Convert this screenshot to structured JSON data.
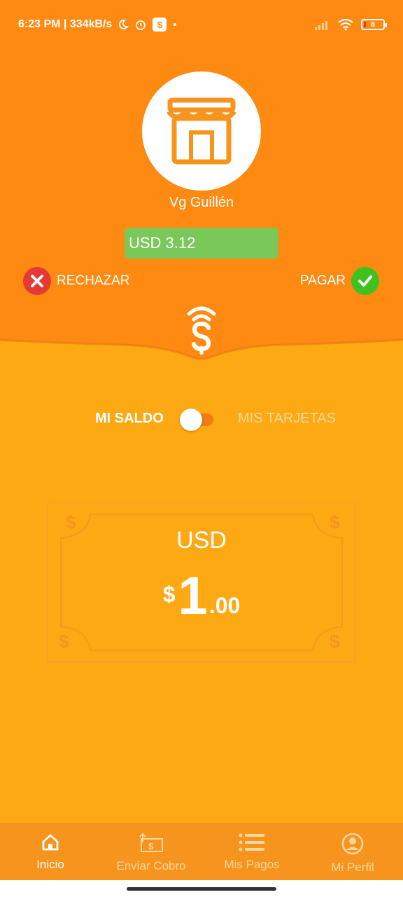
{
  "status_bar": {
    "time_speed": "6:23 PM | 334kB/s",
    "battery": "8"
  },
  "merchant": {
    "name": "Vg Guillén",
    "amount": "USD 3.12"
  },
  "actions": {
    "reject_label": "RECHAZAR",
    "pay_label": "PAGAR"
  },
  "toggle": {
    "left_label": "MI SALDO",
    "right_label": "MIS TARJETAS",
    "selected": "MI SALDO"
  },
  "balance": {
    "currency": "USD",
    "symbol": "$",
    "integer": "1",
    "decimals": ".00"
  },
  "nav": {
    "items": [
      {
        "label": "Inicio",
        "icon": "home-icon",
        "active": true
      },
      {
        "label": "Enviar Cobro",
        "icon": "send-charge-icon",
        "active": false
      },
      {
        "label": "Mis Pagos",
        "icon": "list-icon",
        "active": false
      },
      {
        "label": "Mi Perfil",
        "icon": "profile-icon",
        "active": false
      }
    ]
  },
  "colors": {
    "header_orange": "#FE8A12",
    "background": "#FDA914",
    "nav_bar": "#F7941D",
    "amount_green": "#7BC85A",
    "reject_red": "#E53935",
    "pay_green": "#3FC21F"
  }
}
